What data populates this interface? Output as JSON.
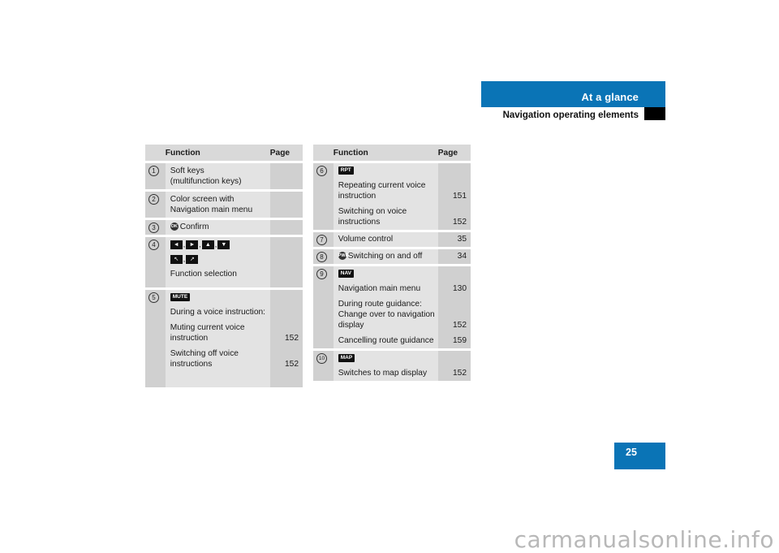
{
  "header": {
    "section_title": "At a glance",
    "subsection_title": "Navigation operating elements",
    "accent_color": "#0a74b6"
  },
  "page_number": "25",
  "watermark": "carmanualsonline.info",
  "tables": [
    {
      "headers": {
        "number": "",
        "function": "Function",
        "page": "Page"
      },
      "rows": [
        {
          "number": "1",
          "lines": [
            {
              "text": "Soft keys",
              "page": ""
            },
            {
              "text": "(multifunction keys)",
              "page": ""
            }
          ]
        },
        {
          "number": "2",
          "lines": [
            {
              "text": "Color screen with",
              "page": ""
            },
            {
              "text": "Navigation main menu",
              "page": ""
            }
          ]
        },
        {
          "number": "3",
          "icon": "ok-button-icon",
          "icon_label": "OK",
          "lines": [
            {
              "text": "Confirm",
              "page": ""
            }
          ]
        },
        {
          "number": "4",
          "arrow_keys": [
            "◄",
            "►",
            "▲",
            "▼"
          ],
          "diag_keys": [
            "↖",
            "↗"
          ],
          "lines": [
            {
              "text": "Function selection",
              "page": ""
            }
          ]
        },
        {
          "number": "5",
          "key": "MUTE",
          "lines": [
            {
              "text": "During a voice instruction:",
              "page": ""
            },
            {
              "text": "Muting current voice",
              "text2": "instruction",
              "page": "152"
            },
            {
              "text": "Switching off voice",
              "text2": "instructions",
              "page": "152"
            }
          ]
        }
      ]
    },
    {
      "headers": {
        "number": "",
        "function": "Function",
        "page": "Page"
      },
      "rows": [
        {
          "number": "6",
          "key": "RPT",
          "lines": [
            {
              "text": "Repeating current voice",
              "text2": "instruction",
              "page": "151"
            },
            {
              "text": "Switching on voice",
              "text2": "instructions",
              "page": "152"
            }
          ]
        },
        {
          "number": "7",
          "lines": [
            {
              "text": "Volume control",
              "page": "35"
            }
          ]
        },
        {
          "number": "8",
          "icon": "power-button-icon",
          "icon_label": "PWR",
          "lines": [
            {
              "text": "Switching on and off",
              "page": "34"
            }
          ]
        },
        {
          "number": "9",
          "key": "NAV",
          "lines": [
            {
              "text": "Navigation main menu",
              "page": "130"
            },
            {
              "text": "During route guidance:",
              "text2": "Change over to navigation",
              "text3": "display",
              "page": "152"
            },
            {
              "text": "Cancelling route guidance",
              "page": "159"
            }
          ]
        },
        {
          "number": "10",
          "key": "MAP",
          "lines": [
            {
              "text": "Switches to map display",
              "page": "152"
            }
          ]
        }
      ]
    }
  ]
}
